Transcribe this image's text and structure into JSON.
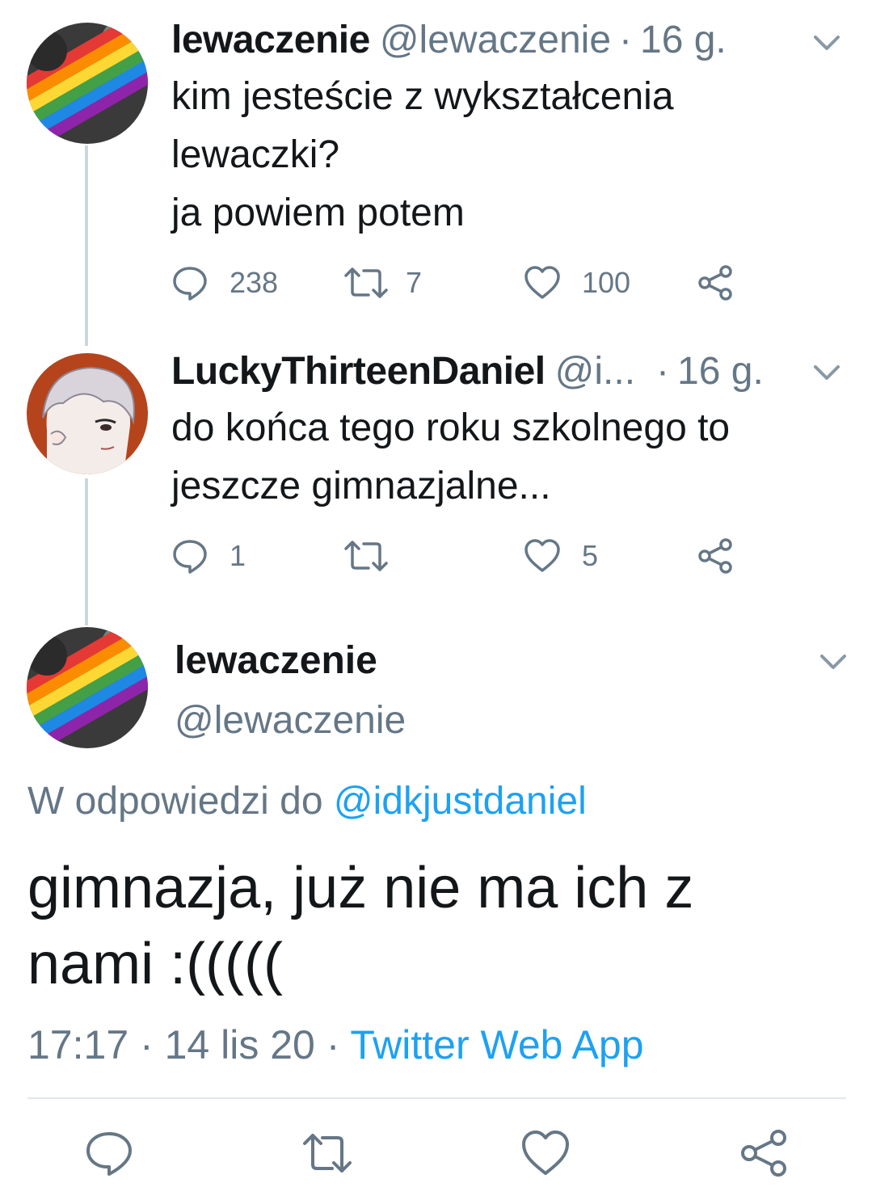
{
  "tweets": [
    {
      "name": "lewaczenie",
      "handle": "@lewaczenie",
      "separator": "·",
      "time": "16 g.",
      "text_lines": [
        "kim jesteście z wykształcenia",
        "lewaczki?",
        "ja powiem potem"
      ],
      "replies": "238",
      "retweets": "7",
      "likes": "100"
    },
    {
      "name": "LuckyThirteenDaniel",
      "handle": "@i...",
      "separator": "·",
      "time": "16 g.",
      "text_lines": [
        "do końca tego roku szkolnego to",
        "jeszcze gimnazjalne..."
      ],
      "replies": "1",
      "retweets": "",
      "likes": "5"
    }
  ],
  "main_tweet": {
    "name": "lewaczenie",
    "handle": "@lewaczenie",
    "reply_prefix": "W odpowiedzi do",
    "reply_mention": "@idkjustdaniel",
    "text_lines": [
      "gimnazja, już nie ma ich z",
      "nami :((((("
    ],
    "time": "17:17",
    "separator": "·",
    "date": "14 lis 20",
    "separator2": "·",
    "source": "Twitter Web App"
  },
  "icons": {
    "reply": "reply-icon",
    "retweet": "retweet-icon",
    "like": "heart-icon",
    "share": "share-icon",
    "menu": "chevron-down-icon"
  },
  "colors": {
    "text": "#14171a",
    "secondary": "#657786",
    "link": "#1da1f2",
    "divider": "#e1e8ed",
    "thread_line": "#ccd6dd"
  }
}
